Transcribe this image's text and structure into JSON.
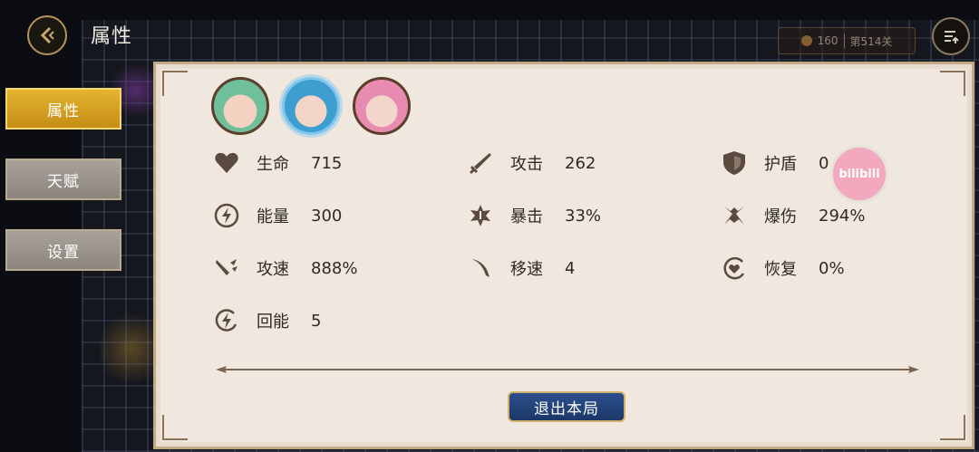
{
  "header": {
    "title": "属性",
    "level_display": {
      "coins": "160",
      "stage": "第514关"
    }
  },
  "tabs": [
    {
      "label": "属性",
      "active": true
    },
    {
      "label": "天赋",
      "active": false
    },
    {
      "label": "设置",
      "active": false
    }
  ],
  "stats": {
    "hp": {
      "label": "生命",
      "value": "715",
      "icon": "heart-icon"
    },
    "energy": {
      "label": "能量",
      "value": "300",
      "icon": "lightning-icon"
    },
    "attack_speed": {
      "label": "攻速",
      "value": "888%",
      "icon": "attack-speed-icon"
    },
    "regen_energy": {
      "label": "回能",
      "value": "5",
      "icon": "energy-regen-icon"
    },
    "attack": {
      "label": "攻击",
      "value": "262",
      "icon": "sword-icon"
    },
    "crit": {
      "label": "暴击",
      "value": "33%",
      "icon": "crit-icon"
    },
    "move_speed": {
      "label": "移速",
      "value": "4",
      "icon": "wing-icon"
    },
    "shield": {
      "label": "护盾",
      "value": "0",
      "icon": "shield-icon"
    },
    "crit_damage": {
      "label": "爆伤",
      "value": "294%",
      "icon": "crit-damage-icon"
    },
    "recovery": {
      "label": "恢复",
      "value": "0%",
      "icon": "recovery-icon"
    }
  },
  "quit_button": {
    "label": "退出本局"
  },
  "watermark": {
    "text": "bilibili"
  },
  "colors": {
    "panel_bg": "#f0e8df",
    "tab_active": "#e0ad2c",
    "tab_inactive": "#9a948c",
    "button_blue": "#24457a",
    "gold_border": "#d2b168"
  }
}
